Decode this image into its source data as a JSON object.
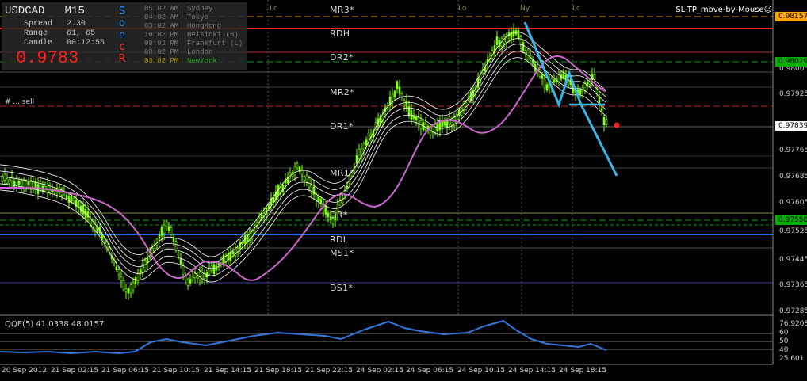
{
  "info": {
    "symbol": "USDCAD",
    "timeframe": "M15",
    "spread_label": "Spread",
    "spread_value": "2.30",
    "range_label": "Range",
    "range_value": "61, 65",
    "candle_label": "Candle",
    "candle_value": "00:12:56",
    "big_price": "0.9783",
    "letters": [
      "S",
      "o",
      "n",
      "c",
      "R"
    ]
  },
  "sessions": [
    {
      "time": "05:02 AM",
      "name": "Sydney"
    },
    {
      "time": "04:02 AM",
      "name": "Tokyo"
    },
    {
      "time": "03:02 AM",
      "name": "HongKong"
    },
    {
      "time": "10:02 PM",
      "name": "Helsinki (B)"
    },
    {
      "time": "09:02 PM",
      "name": "Frankfurt (L)"
    },
    {
      "time": "08:02 PM",
      "name": "London"
    },
    {
      "time": "03:02 PM",
      "name": "NewYork"
    }
  ],
  "ea_label": "SL-TP_move-by-Mouse☺",
  "order_label": "#  ...  sell",
  "session_markers": [
    "Lc",
    "Lo",
    "Ny",
    "Lc"
  ],
  "pivots": [
    "MR3*",
    "RDH",
    "DR2*",
    "MR2*",
    "DR1*",
    "MR1*",
    "DR*",
    "RDL",
    "MS1*",
    "DS1*"
  ],
  "price_scale": [
    "0.98005",
    "0.97925",
    "0.97765",
    "0.97685",
    "0.97605",
    "0.97525",
    "0.97445",
    "0.97365",
    "0.97285"
  ],
  "price_tags": [
    {
      "value": "0.98157",
      "bg": "#ffa500",
      "fg": "#000000"
    },
    {
      "value": "0.98029",
      "bg": "#00b000",
      "fg": "#000000"
    },
    {
      "value": "0.97839",
      "bg": "#ffffff",
      "fg": "#000000"
    },
    {
      "value": "0.97558",
      "bg": "#00b000",
      "fg": "#000000"
    }
  ],
  "price_label_extra": "0.98005",
  "qqe": {
    "label": "QQE(5) 41.0338 48.0157",
    "scale": [
      "76.9208",
      "60",
      "50",
      "40",
      "25.601"
    ]
  },
  "time_labels": [
    "20 Sep 2012",
    "21 Sep 02:15",
    "21 Sep 06:15",
    "21 Sep 10:15",
    "21 Sep 14:15",
    "21 Sep 18:15",
    "21 Sep 22:15",
    "24 Sep 02:15",
    "24 Sep 06:15",
    "24 Sep 10:15",
    "24 Sep 14:15",
    "24 Sep 18:15"
  ],
  "colors": {
    "candle": "#7fff00",
    "ma_purple": "#cc66cc",
    "envelope": "#ffffff",
    "trend_line": "#33b8e8",
    "rdh": "#ff2020",
    "rdl": "#2266ff",
    "qqe_line": "#3377dd"
  }
}
